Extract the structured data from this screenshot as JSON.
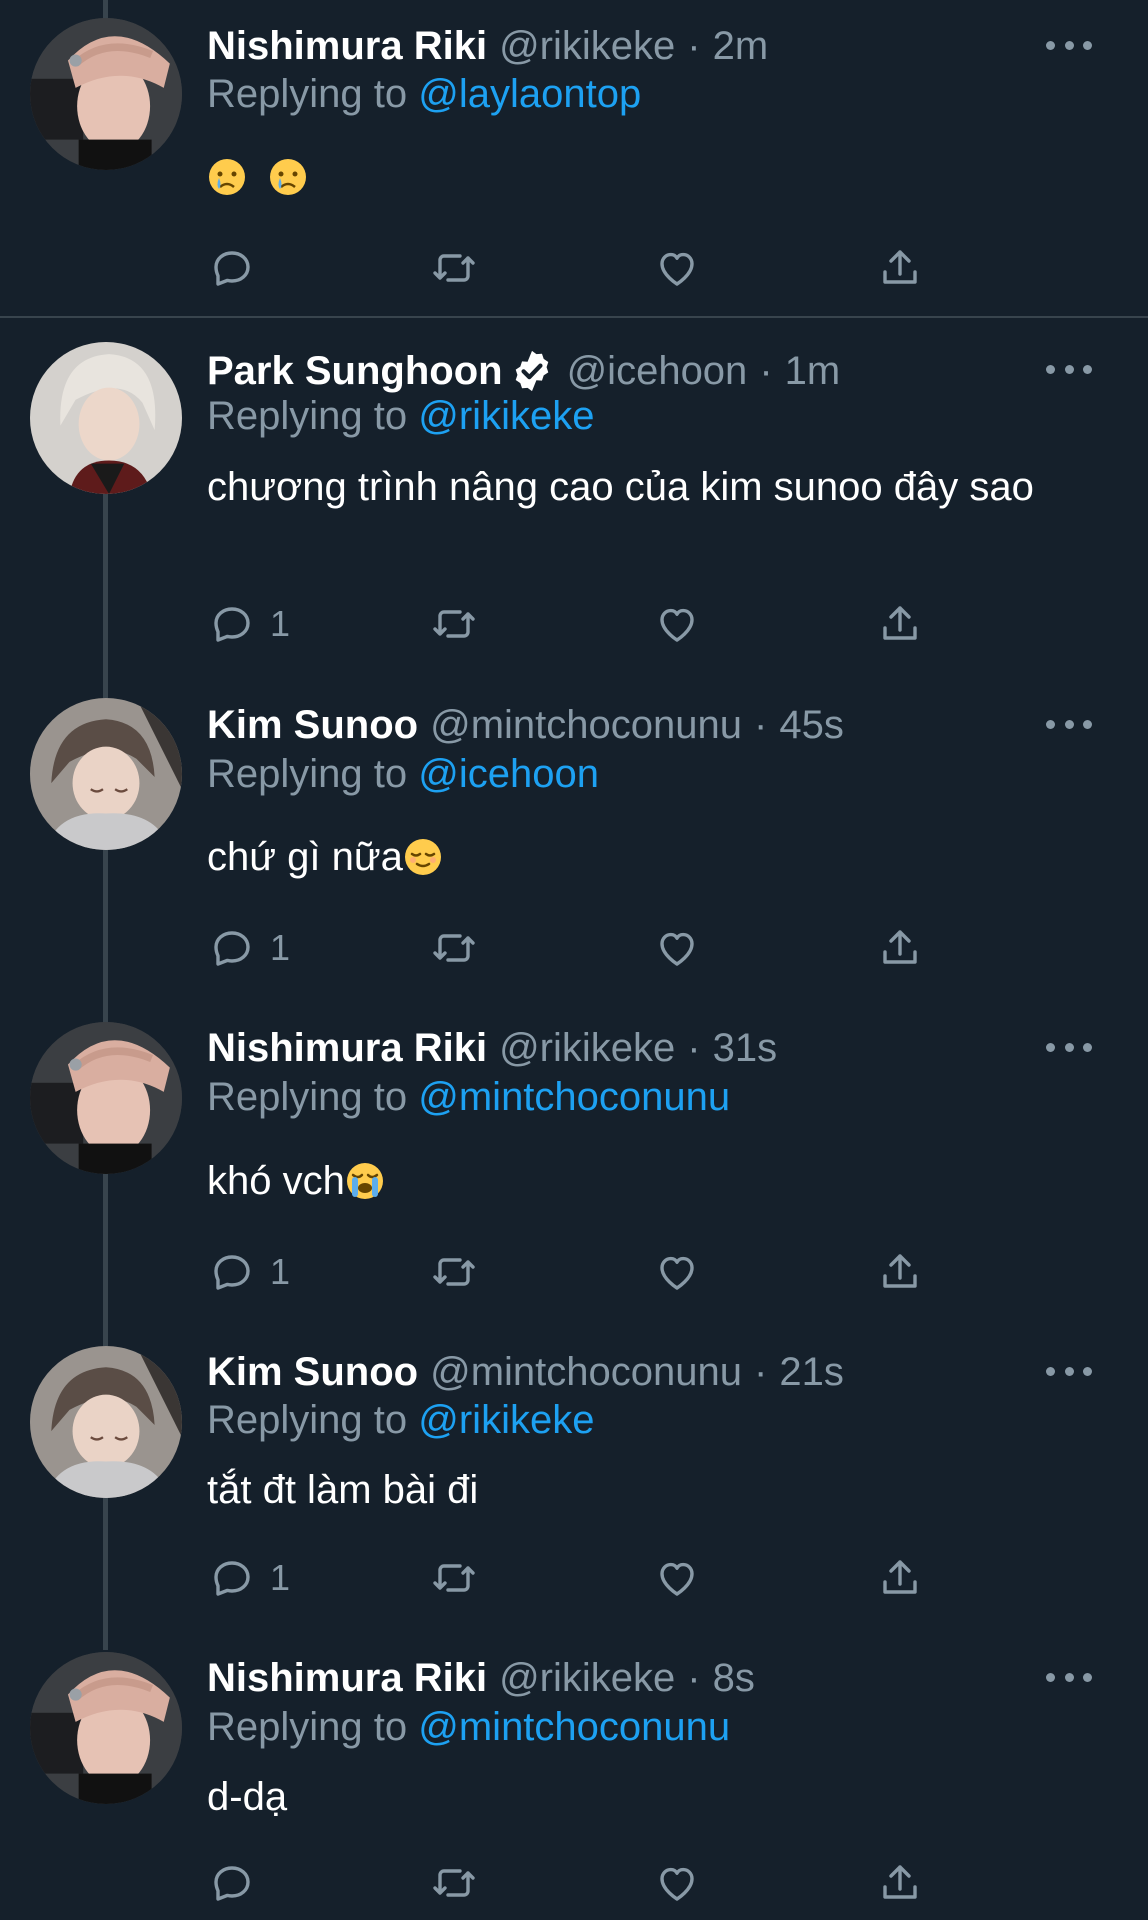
{
  "replying_prefix": "Replying to",
  "tweets": [
    {
      "name": "Nishimura Riki",
      "handle": "@rikikeke",
      "time": "2m",
      "reply_to": "@laylaontop",
      "text": "",
      "emojis": [
        "crying-face",
        "crying-face"
      ],
      "reply_count": "",
      "avatar": "riki"
    },
    {
      "name": "Park Sunghoon",
      "handle": "@icehoon",
      "time": "1m",
      "reply_to": "@rikikeke",
      "text": "chương trình nâng cao của kim sunoo đây sao",
      "emojis": [],
      "reply_count": "1",
      "verified": true,
      "avatar": "sunghoon"
    },
    {
      "name": "Kim Sunoo",
      "handle": "@mintchoconunu",
      "time": "45s",
      "reply_to": "@icehoon",
      "text": "chứ gì nữa",
      "emojis": [
        "relieved-face"
      ],
      "reply_count": "1",
      "avatar": "sunoo"
    },
    {
      "name": "Nishimura Riki",
      "handle": "@rikikeke",
      "time": "31s",
      "reply_to": "@mintchoconunu",
      "text": "khó vch",
      "emojis": [
        "loudly-crying-face"
      ],
      "reply_count": "1",
      "avatar": "riki"
    },
    {
      "name": "Kim Sunoo",
      "handle": "@mintchoconunu",
      "time": "21s",
      "reply_to": "@rikikeke",
      "text": "tắt đt làm bài đi",
      "emojis": [],
      "reply_count": "1",
      "avatar": "sunoo"
    },
    {
      "name": "Nishimura Riki",
      "handle": "@rikikeke",
      "time": "8s",
      "reply_to": "@mintchoconunu",
      "text": "d-dạ",
      "emojis": [],
      "reply_count": "",
      "avatar": "riki"
    }
  ],
  "icons": {
    "reply": "reply-icon",
    "retweet": "retweet-icon",
    "like": "like-icon",
    "share": "share-icon",
    "more": "more-icon",
    "verified": "verified-badge-icon"
  },
  "colors": {
    "background": "#15202b",
    "secondary_text": "#8899a6",
    "link": "#1da1f2",
    "divider": "#38444d"
  }
}
